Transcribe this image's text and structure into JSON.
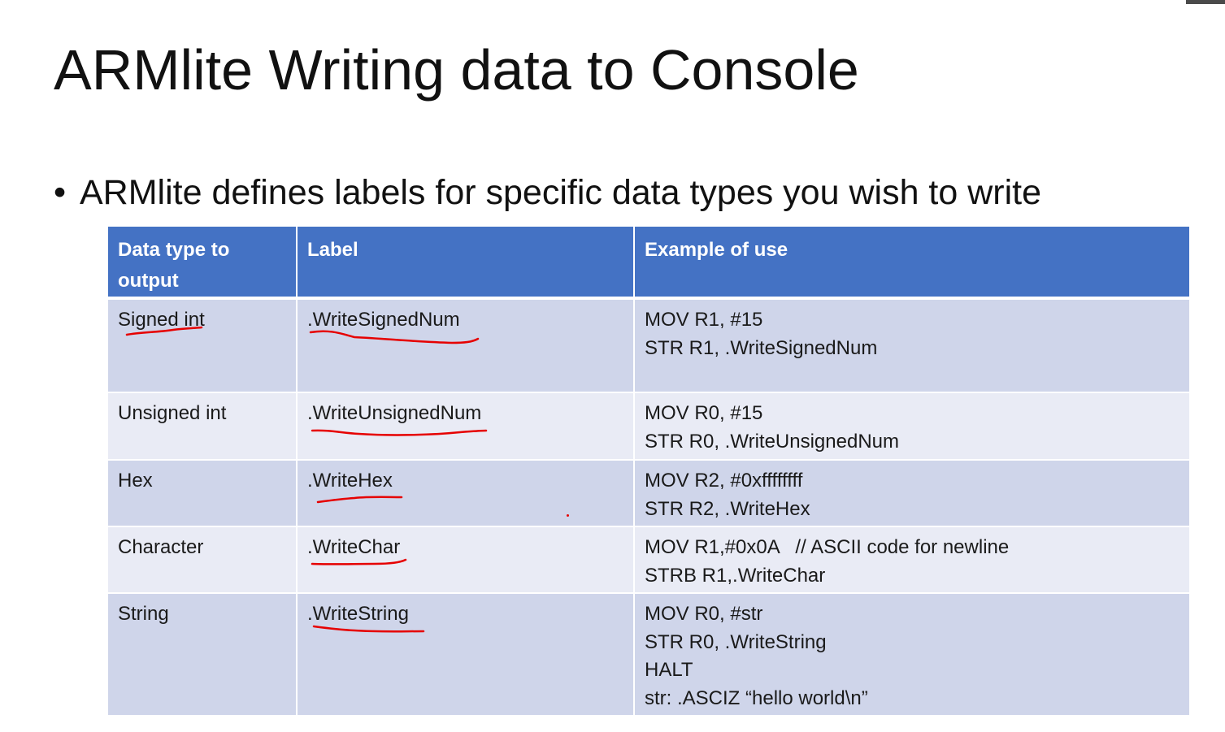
{
  "slide": {
    "title": "ARMlite Writing data to Console",
    "bullet": "ARMlite defines labels for specific data types you wish to write"
  },
  "table": {
    "headers": [
      "Data type to output",
      "Label",
      "Example of use"
    ],
    "rows": [
      {
        "type": "Signed int",
        "label": ".WriteSignedNum",
        "example": [
          "MOV R1, #15",
          "STR R1, .WriteSignedNum"
        ]
      },
      {
        "type": "Unsigned int",
        "label": ".WriteUnsignedNum",
        "example": [
          "MOV R0, #15",
          "STR R0, .WriteUnsignedNum"
        ]
      },
      {
        "type": "Hex",
        "label": ".WriteHex",
        "example": [
          "MOV R2, #0xffffffff",
          "STR R2, .WriteHex"
        ]
      },
      {
        "type": "Character",
        "label": ".WriteChar",
        "example": [
          "MOV R1,#0x0A   // ASCII code for newline",
          "STRB R1,.WriteChar"
        ]
      },
      {
        "type": "String",
        "label": ".WriteString",
        "example": [
          "MOV R0, #str",
          "STR R0, .WriteString",
          "HALT",
          "str: .ASCIZ “hello world\\n”"
        ]
      }
    ]
  },
  "colors": {
    "header_bg": "#4472c4",
    "row_odd_bg": "#cfd5ea",
    "row_even_bg": "#e9ebf5",
    "annotation": "#e60000"
  }
}
